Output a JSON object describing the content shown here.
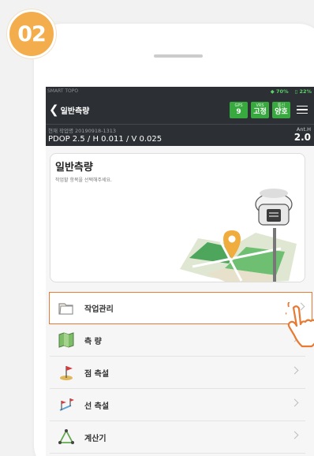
{
  "step_number": "02",
  "statusbar": {
    "app_name": "SMART TOPO",
    "signal": "70%",
    "battery": "22%"
  },
  "appbar": {
    "title": "일반측량"
  },
  "gnss": [
    {
      "label": "GPS",
      "value": "9"
    },
    {
      "label": "VRS",
      "value": "고정"
    },
    {
      "label": "통신",
      "value": "양호"
    }
  ],
  "info": {
    "job_caption": "현재 작업명 20190918-1313",
    "pdop_line": "PDOP 2.5 / H 0.011 / V 0.025",
    "anth_label": "Ant.H",
    "anth_value": "2.0"
  },
  "hero": {
    "title": "일반측량",
    "subtitle": "작업할 항목을 선택해주세요."
  },
  "menu": [
    {
      "label": "작업관리",
      "icon": "folder-icon",
      "selected": true
    },
    {
      "label": "측 량",
      "icon": "survey-map-icon",
      "selected": false
    },
    {
      "label": "점 측설",
      "icon": "point-stakeout-flag-icon",
      "selected": false
    },
    {
      "label": "선 측설",
      "icon": "line-stakeout-flags-icon",
      "selected": false
    },
    {
      "label": "계산기",
      "icon": "calculator-icon",
      "selected": false
    }
  ],
  "colors": {
    "accent": "#f3ad4c",
    "header": "#2c2f33",
    "gnss_green": "#38a93f",
    "selection": "#e87a33"
  }
}
